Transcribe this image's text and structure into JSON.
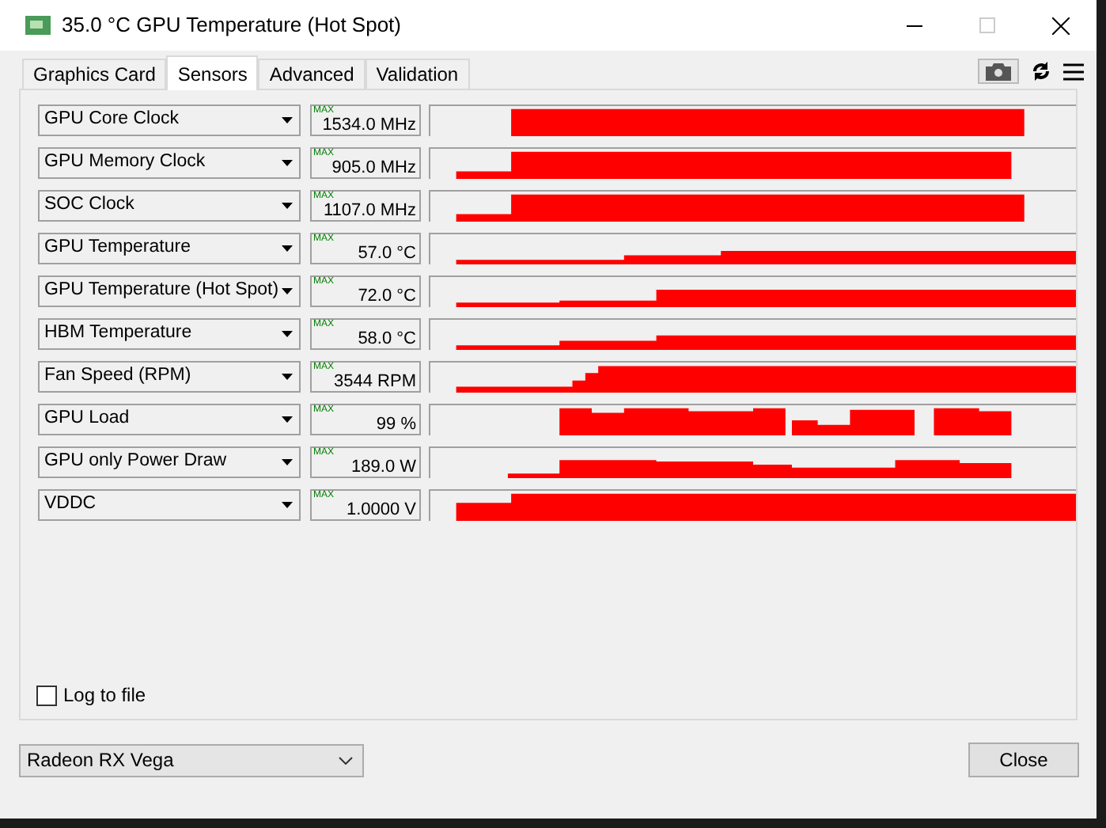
{
  "window": {
    "title": "35.0 °C GPU Temperature (Hot Spot)"
  },
  "tabs": [
    {
      "label": "Graphics Card",
      "selected": false
    },
    {
      "label": "Sensors",
      "selected": true
    },
    {
      "label": "Advanced",
      "selected": false
    },
    {
      "label": "Validation",
      "selected": false
    }
  ],
  "sensors": [
    {
      "name": "GPU Core Clock",
      "max_label": "MAX",
      "value": "1534.0 MHz"
    },
    {
      "name": "GPU Memory Clock",
      "max_label": "MAX",
      "value": "905.0 MHz"
    },
    {
      "name": "SOC Clock",
      "max_label": "MAX",
      "value": "1107.0 MHz"
    },
    {
      "name": "GPU Temperature",
      "max_label": "MAX",
      "value": "57.0 °C"
    },
    {
      "name": "GPU Temperature (Hot Spot)",
      "max_label": "MAX",
      "value": "72.0 °C"
    },
    {
      "name": "HBM Temperature",
      "max_label": "MAX",
      "value": "58.0 °C"
    },
    {
      "name": "Fan Speed (RPM)",
      "max_label": "MAX",
      "value": "3544 RPM"
    },
    {
      "name": "GPU Load",
      "max_label": "MAX",
      "value": "99 %"
    },
    {
      "name": "GPU only Power Draw",
      "max_label": "MAX",
      "value": "189.0 W"
    },
    {
      "name": "VDDC",
      "max_label": "MAX",
      "value": "1.0000 V"
    }
  ],
  "log_to_file": {
    "label": "Log to file",
    "checked": false
  },
  "device_select": {
    "value": "Radeon RX Vega"
  },
  "close_button": "Close"
}
